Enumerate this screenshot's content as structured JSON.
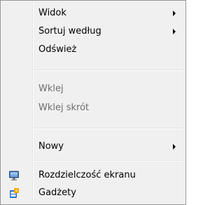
{
  "context_menu": {
    "items": [
      {
        "label": "Widok"
      },
      {
        "label": "Sortuj według"
      },
      {
        "label": "Odśwież"
      },
      {
        "label": "Wklej"
      },
      {
        "label": "Wklej skrót"
      },
      {
        "label": "Nowy"
      },
      {
        "label": "Rozdzielczość ekranu"
      },
      {
        "label": "Gadżety"
      }
    ]
  },
  "icons": {
    "screen_resolution": "monitor-icon",
    "gadgets": "gadgets-icon"
  },
  "colors": {
    "menu_background": "#f0f0f0",
    "disabled_text": "#6d6d6d",
    "border": "#979797"
  }
}
